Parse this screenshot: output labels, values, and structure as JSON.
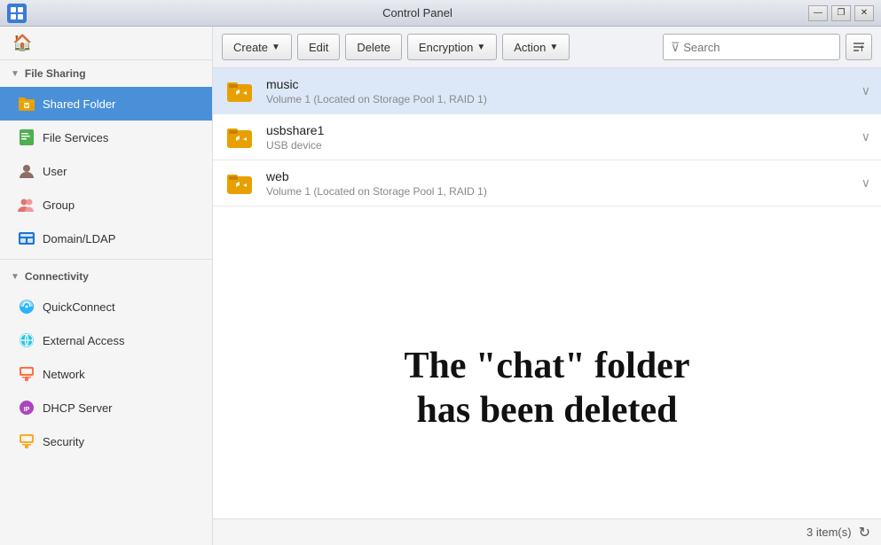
{
  "titleBar": {
    "title": "Control Panel",
    "minBtn": "—",
    "restoreBtn": "❐",
    "closeBtn": "✕"
  },
  "sidebar": {
    "sections": [
      {
        "id": "file-sharing",
        "label": "File Sharing",
        "expanded": true,
        "items": [
          {
            "id": "shared-folder",
            "label": "Shared Folder",
            "active": true
          },
          {
            "id": "file-services",
            "label": "File Services"
          },
          {
            "id": "user",
            "label": "User"
          },
          {
            "id": "group",
            "label": "Group"
          },
          {
            "id": "domain-ldap",
            "label": "Domain/LDAP"
          }
        ]
      },
      {
        "id": "connectivity",
        "label": "Connectivity",
        "expanded": true,
        "items": [
          {
            "id": "quickconnect",
            "label": "QuickConnect"
          },
          {
            "id": "external-access",
            "label": "External Access"
          },
          {
            "id": "network",
            "label": "Network"
          },
          {
            "id": "dhcp-server",
            "label": "DHCP Server"
          },
          {
            "id": "security",
            "label": "Security"
          }
        ]
      }
    ]
  },
  "toolbar": {
    "createLabel": "Create",
    "editLabel": "Edit",
    "deleteLabel": "Delete",
    "encryptionLabel": "Encryption",
    "actionLabel": "Action",
    "searchPlaceholder": "Search"
  },
  "folders": [
    {
      "id": "music",
      "name": "music",
      "desc": "Volume 1 (Located on Storage Pool 1, RAID 1)",
      "selected": true
    },
    {
      "id": "usbshare1",
      "name": "usbshare1",
      "desc": "USB device",
      "selected": false
    },
    {
      "id": "web",
      "name": "web",
      "desc": "Volume 1 (Located on Storage Pool 1, RAID 1)",
      "selected": false
    }
  ],
  "notification": {
    "line1": "The \"chat\" folder",
    "line2": "has been deleted"
  },
  "statusBar": {
    "itemCount": "3 item(s)"
  }
}
